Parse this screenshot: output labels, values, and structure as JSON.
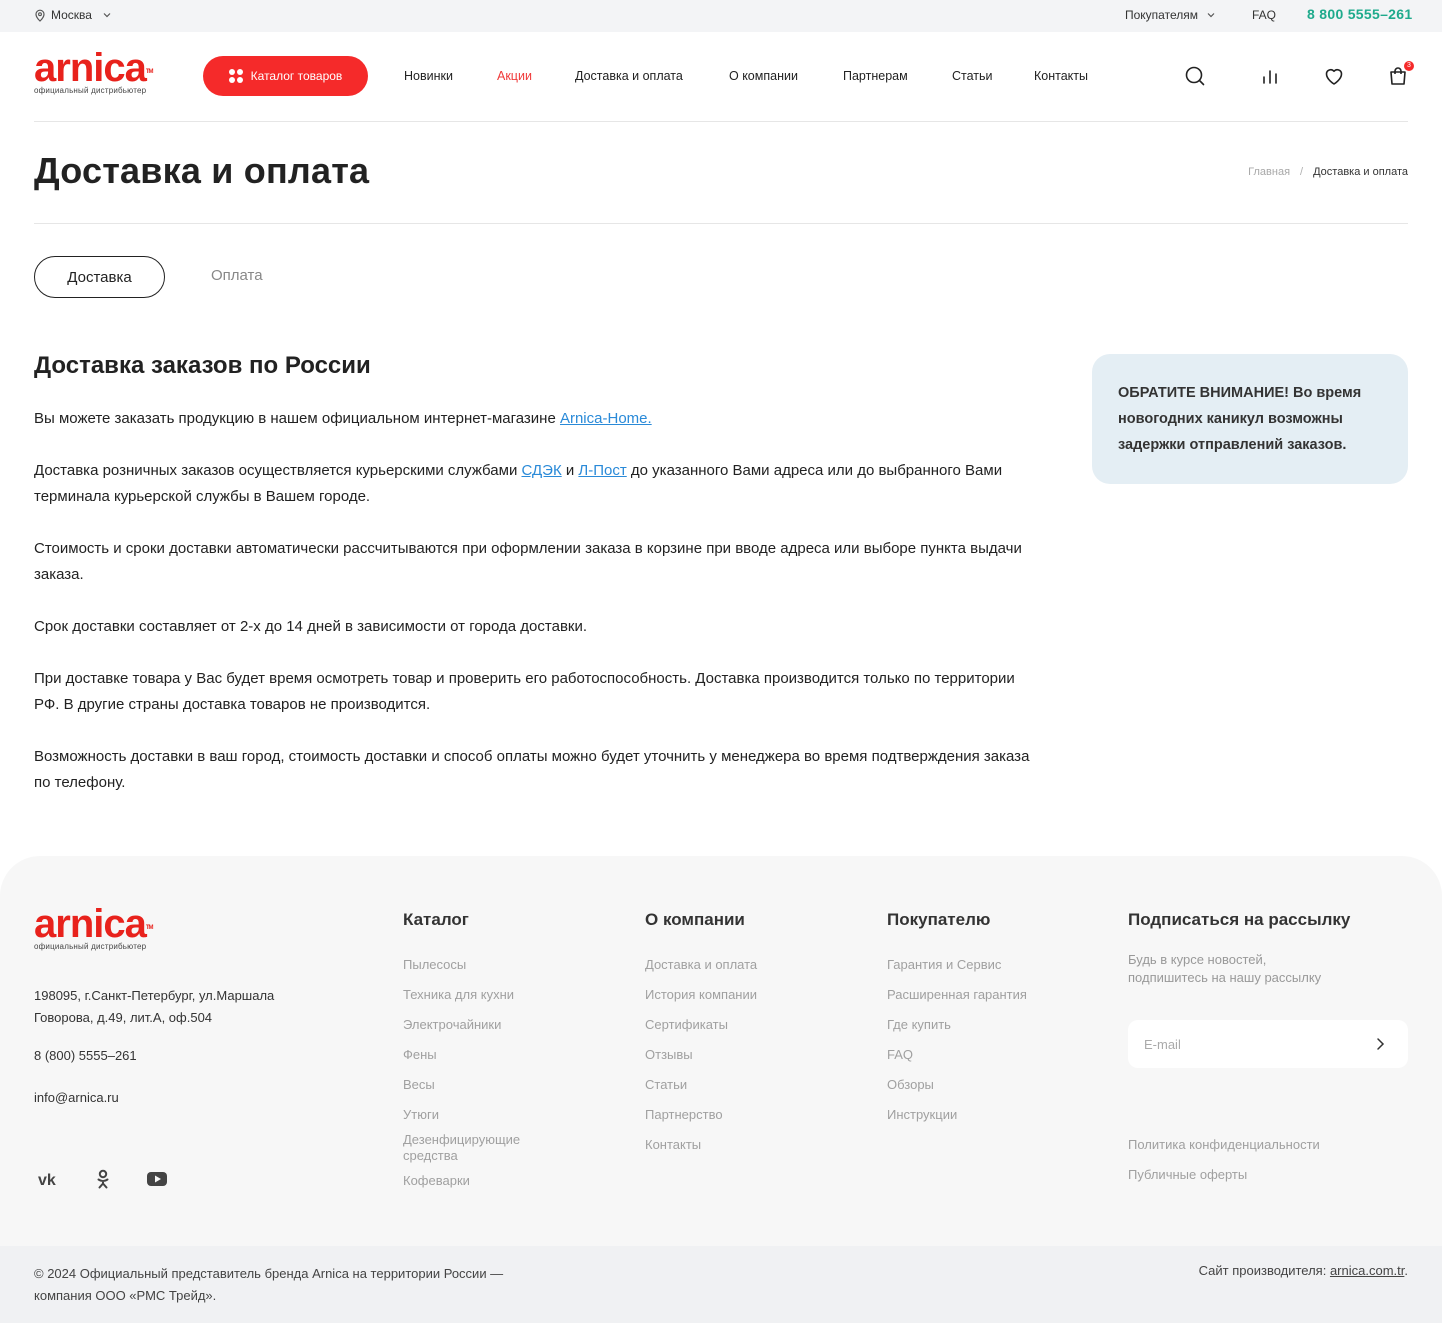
{
  "topbar": {
    "city": "Москва",
    "buyers": "Покупателям",
    "faq": "FAQ",
    "phone": "8 800 5555–261"
  },
  "brand": {
    "logo_word": "arnica",
    "logo_tm": "TM",
    "logo_sub": "официальный дистрибьютер",
    "accent_color": "#f52a2a",
    "phone_color": "#1eaa8c",
    "link_color": "#2a8ad8"
  },
  "header": {
    "catalog_button": "Каталог товаров",
    "nav": [
      "Новинки",
      "Акции",
      "Доставка и оплата",
      "О компании",
      "Партнерам",
      "Статьи",
      "Контакты"
    ],
    "active_nav": "Акции",
    "cart_count": "3"
  },
  "page": {
    "title": "Доставка и оплата",
    "breadcrumb": {
      "home": "Главная",
      "separator": "/",
      "current": "Доставка и оплата"
    },
    "tabs": {
      "delivery": "Доставка",
      "payment": "Оплата"
    },
    "section_title": "Доставка заказов по России",
    "paragraphs": {
      "p1_text": "Вы можете заказать продукцию в нашем официальном интернет-магазине ",
      "p1_link": "Arnica-Home.",
      "p2_a": "Доставка розничных заказов осуществляется курьерскими службами ",
      "p2_link1": "СДЭК",
      "p2_b": " и ",
      "p2_link2": "Л-Пост",
      "p2_c": " до указанного Вами адреса или до выбранного Вами терминала курьерской службы в Вашем городе.",
      "p3": "Стоимость и сроки доставки автоматически рассчитываются при оформлении заказа в корзине при вводе адреса или выборе пункта выдачи заказа.",
      "p4": "Срок доставки составляет от 2-х до 14 дней в зависимости от города доставки.",
      "p5": "При доставке товара у Вас будет время осмотреть товар и проверить его работоспособность. Доставка производится только по территории РФ. В другие страны доставка товаров не производится.",
      "p6": "Возможность доставки в ваш город, стоимость доставки и способ оплаты можно будет уточнить у менеджера во время подтверждения заказа по телефону."
    },
    "notice": "ОБРАТИТЕ ВНИМАНИЕ! Во время новогодних каникул возможны задержки отправлений заказов."
  },
  "footer": {
    "address_line1": "198095, г.Санкт-Петербург, ул.Маршала",
    "address_line2": "Говорова, д.49, лит.А, оф.504",
    "phone": "8 (800) 5555–261",
    "email": "info@arnica.ru",
    "social": [
      "vk-icon",
      "odnoklassniki-icon",
      "youtube-icon"
    ],
    "catalog": {
      "title": "Каталог",
      "links": [
        "Пылесосы",
        "Техника для кухни",
        "Электрочайники",
        "Фены",
        "Весы",
        "Утюги",
        "Дезенфицирующие средства",
        "Кофеварки"
      ]
    },
    "company": {
      "title": "О компании",
      "links": [
        "Доставка и оплата",
        "История компании",
        "Сертификаты",
        "Отзывы",
        "Статьи",
        "Партнерство",
        "Контакты"
      ]
    },
    "buyer": {
      "title": "Покупателю",
      "links": [
        "Гарантия и Сервис",
        "Расширенная гарантия",
        "Где купить",
        "FAQ",
        "Обзоры",
        "Инструкции"
      ]
    },
    "subscribe": {
      "title": "Подписаться на рассылку",
      "text_line1": "Будь в курсе новостей,",
      "text_line2": "подпишитесь на нашу рассылку",
      "placeholder": "E-mail"
    },
    "legal": [
      "Политика конфиденциальности",
      "Публичные оферты"
    ],
    "copyright": "© 2024 Официальный представитель бренда Arnica на территории России — компания ООО «РМС Трейд».",
    "maker_label": "Сайт производителя: ",
    "maker_link": "arnica.com.tr",
    "maker_dot": "."
  }
}
